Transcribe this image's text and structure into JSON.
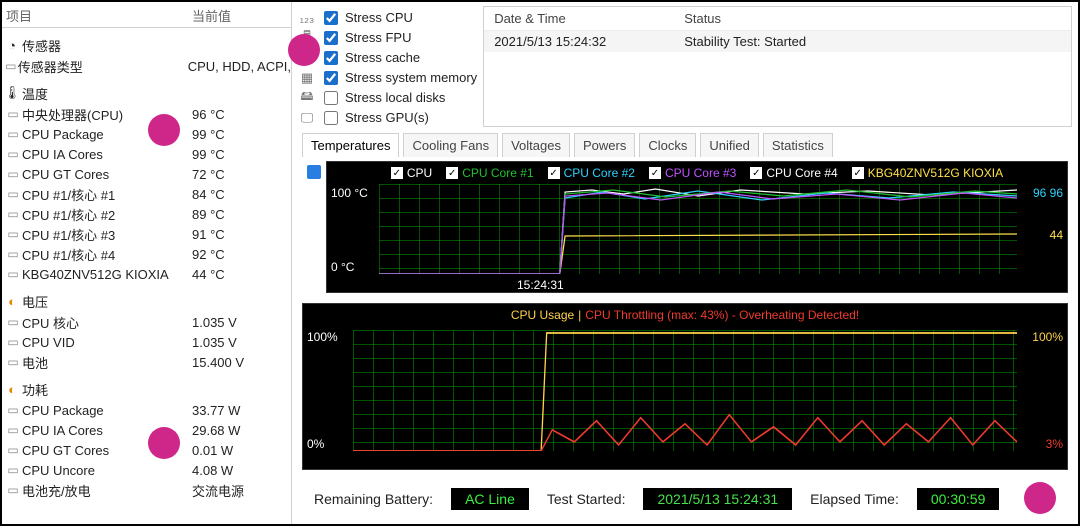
{
  "left": {
    "h1": "项目",
    "h2": "当前值",
    "sensors_cat": "传感器",
    "sensor_type_label": "传感器类型",
    "sensor_type_value": "CPU, HDD, ACPI,",
    "temp_cat": "温度",
    "temps": [
      {
        "label": "中央处理器(CPU)",
        "val": "96 °C"
      },
      {
        "label": "CPU Package",
        "val": "99 °C"
      },
      {
        "label": "CPU IA Cores",
        "val": "99 °C"
      },
      {
        "label": "CPU GT Cores",
        "val": "72 °C"
      },
      {
        "label": "CPU #1/核心 #1",
        "val": "84 °C"
      },
      {
        "label": "CPU #1/核心 #2",
        "val": "89 °C"
      },
      {
        "label": "CPU #1/核心 #3",
        "val": "91 °C"
      },
      {
        "label": "CPU #1/核心 #4",
        "val": "92 °C"
      },
      {
        "label": "KBG40ZNV512G KIOXIA",
        "val": "44 °C"
      }
    ],
    "volt_cat": "电压",
    "volts": [
      {
        "label": "CPU 核心",
        "val": "1.035 V"
      },
      {
        "label": "CPU VID",
        "val": "1.035 V"
      },
      {
        "label": "电池",
        "val": "15.400 V"
      }
    ],
    "power_cat": "功耗",
    "powers": [
      {
        "label": "CPU Package",
        "val": "33.77 W"
      },
      {
        "label": "CPU IA Cores",
        "val": "29.68 W"
      },
      {
        "label": "CPU GT Cores",
        "val": "0.01 W"
      },
      {
        "label": "CPU Uncore",
        "val": "4.08 W"
      },
      {
        "label": "电池充/放电",
        "val": "交流电源"
      }
    ]
  },
  "stress": [
    {
      "checked": true,
      "label": "Stress CPU"
    },
    {
      "checked": true,
      "label": "Stress FPU"
    },
    {
      "checked": true,
      "label": "Stress cache"
    },
    {
      "checked": true,
      "label": "Stress system memory"
    },
    {
      "checked": false,
      "label": "Stress local disks"
    },
    {
      "checked": false,
      "label": "Stress GPU(s)"
    }
  ],
  "log": {
    "h1": "Date & Time",
    "h2": "Status",
    "r1c1": "2021/5/13 15:24:32",
    "r1c2": "Stability Test: Started"
  },
  "tabs": [
    "Temperatures",
    "Cooling Fans",
    "Voltages",
    "Powers",
    "Clocks",
    "Unified",
    "Statistics"
  ],
  "graph1": {
    "legend": [
      {
        "color": "#ffffff",
        "name": "CPU"
      },
      {
        "color": "#20c030",
        "name": "CPU Core #1"
      },
      {
        "color": "#2fd2ff",
        "name": "CPU Core #2"
      },
      {
        "color": "#c152ff",
        "name": "CPU Core #3"
      },
      {
        "color": "#ffffff",
        "name": "CPU Core #4"
      },
      {
        "color": "#ffe14a",
        "name": "KBG40ZNV512G KIOXIA"
      }
    ],
    "ymax": "100 °C",
    "ymin": "0 °C",
    "r_top": "96 96",
    "r_bot": "44",
    "time": "15:24:31"
  },
  "graph2": {
    "title_a": "CPU Usage",
    "title_b": "CPU Throttling (max: 43%) - Overheating Detected!",
    "ltop": "100%",
    "lbot": "0%",
    "rtop": "100%",
    "rbot": "3%"
  },
  "status": {
    "batt_lbl": "Remaining Battery:",
    "batt_val": "AC Line",
    "start_lbl": "Test Started:",
    "start_val": "2021/5/13 15:24:31",
    "elapsed_lbl": "Elapsed Time:",
    "elapsed_val": "00:30:59"
  }
}
